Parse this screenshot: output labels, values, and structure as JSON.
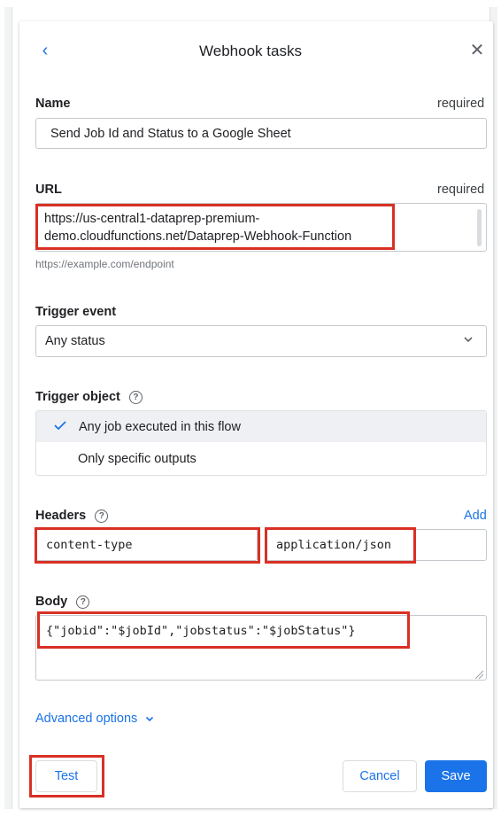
{
  "dialog": {
    "title": "Webhook tasks",
    "back_icon": "chevron-left-icon",
    "close_icon": "close-icon"
  },
  "name_field": {
    "label": "Name",
    "required_text": "required",
    "value": "Send Job Id and Status to a Google Sheet"
  },
  "url_field": {
    "label": "URL",
    "required_text": "required",
    "value_line1": "https://us-central1-dataprep-premium-",
    "value_line2": "demo.cloudfunctions.net/Dataprep-Webhook-Function",
    "hint": "https://example.com/endpoint"
  },
  "trigger_event": {
    "label": "Trigger event",
    "selected": "Any status"
  },
  "trigger_object": {
    "label": "Trigger object",
    "options": [
      {
        "label": "Any job executed in this flow",
        "selected": true
      },
      {
        "label": "Only specific outputs",
        "selected": false
      }
    ]
  },
  "headers": {
    "label": "Headers",
    "add_label": "Add",
    "key": "content-type",
    "value": "application/json"
  },
  "body": {
    "label": "Body",
    "value": "{\"jobid\":\"$jobId\",\"jobstatus\":\"$jobStatus\"}"
  },
  "advanced": {
    "label": "Advanced options"
  },
  "footer": {
    "test_label": "Test",
    "cancel_label": "Cancel",
    "save_label": "Save"
  },
  "colors": {
    "accent": "#1a73e8",
    "highlight": "#d93025"
  }
}
